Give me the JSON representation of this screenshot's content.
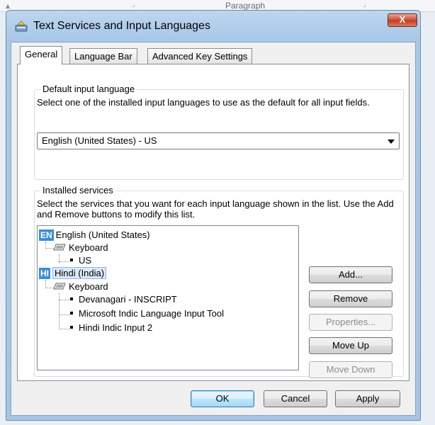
{
  "background": {
    "partial_label": "Paragraph"
  },
  "window": {
    "title": "Text Services and Input Languages",
    "close_symbol": "X"
  },
  "tabs": [
    {
      "label": "General"
    },
    {
      "label": "Language Bar"
    },
    {
      "label": "Advanced Key Settings"
    }
  ],
  "default_input": {
    "group_label": "Default input language",
    "description": "Select one of the installed input languages to use as the default for all input fields.",
    "selected_value": "English (United States) - US"
  },
  "installed_services": {
    "group_label": "Installed services",
    "description": "Select the services that you want for each input language shown in the list. Use the Add and Remove buttons to modify this list.",
    "tree": {
      "en_badge": "EN",
      "en_language": "English (United States)",
      "en_keyboard": "Keyboard",
      "en_us": "US",
      "hi_badge": "HI",
      "hi_language": "Hindi (India)",
      "hi_keyboard": "Keyboard",
      "hi_items": [
        "Devanagari - INSCRIPT",
        "Microsoft Indic Language Input Tool",
        "Hindi Indic Input 2"
      ]
    },
    "buttons": {
      "add": "Add...",
      "remove": "Remove",
      "properties": "Properties...",
      "move_up": "Move Up",
      "move_down": "Move Down"
    }
  },
  "footer": {
    "ok": "OK",
    "cancel": "Cancel",
    "apply": "Apply"
  },
  "colors": {
    "badge": "#3c8ddb",
    "selection": "#dbe8f7",
    "close_button": "#c2391f"
  }
}
